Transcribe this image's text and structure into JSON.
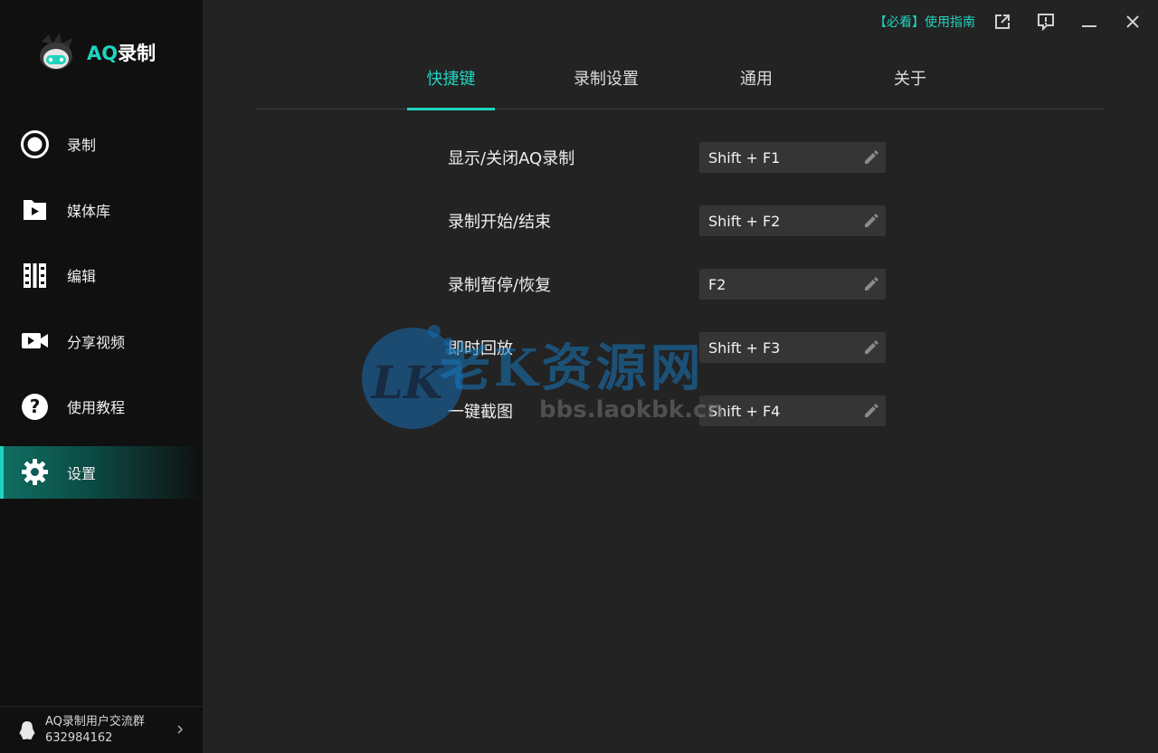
{
  "app": {
    "logo_prefix": "AQ",
    "logo_suffix": "录制",
    "accent_color": "#1fd4bf"
  },
  "sidebar": {
    "items": [
      {
        "label": "录制",
        "icon": "record-icon"
      },
      {
        "label": "媒体库",
        "icon": "media-folder-icon"
      },
      {
        "label": "编辑",
        "icon": "film-edit-icon"
      },
      {
        "label": "分享视频",
        "icon": "video-camera-icon"
      },
      {
        "label": "使用教程",
        "icon": "help-icon"
      },
      {
        "label": "设置",
        "icon": "gear-icon",
        "active": true
      }
    ],
    "group": {
      "name": "AQ录制用户交流群",
      "number": "632984162"
    }
  },
  "topbar": {
    "guide_label": "【必看】使用指南"
  },
  "tabs": [
    {
      "label": "快捷键",
      "active": true
    },
    {
      "label": "录制设置"
    },
    {
      "label": "通用"
    },
    {
      "label": "关于"
    }
  ],
  "shortcuts": [
    {
      "label": "显示/关闭AQ录制",
      "key": "Shift + F1"
    },
    {
      "label": "录制开始/结束",
      "key": "Shift + F2"
    },
    {
      "label": "录制暂停/恢复",
      "key": "F2"
    },
    {
      "label": "即时回放",
      "key": "Shift + F3"
    },
    {
      "label": "一键截图",
      "key": "Shift + F4"
    }
  ],
  "watermark": {
    "title": "老K资源网",
    "url": "bbs.laokbk.cn"
  }
}
